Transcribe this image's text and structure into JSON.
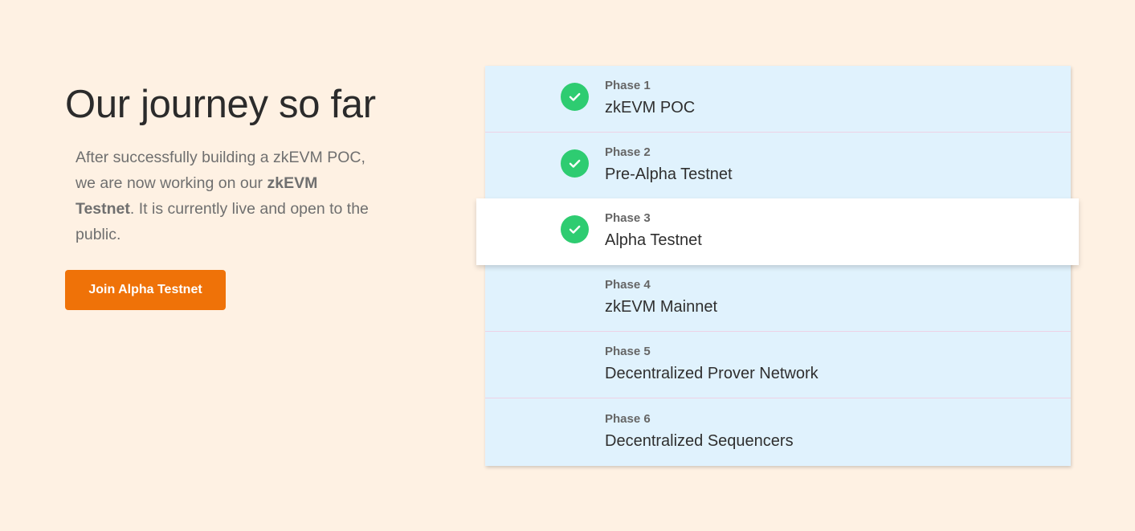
{
  "hero": {
    "title": "Our journey so far",
    "description_part1": "After successfully building a zkEVM POC, we are now working on our ",
    "description_bold": "zkEVM Testnet",
    "description_part2": ". It is currently live and open to the public.",
    "cta_label": "Join Alpha Testnet"
  },
  "phases": [
    {
      "label": "Phase 1",
      "name": "zkEVM POC",
      "completed": true,
      "active": false,
      "icon": "check-circle-icon"
    },
    {
      "label": "Phase 2",
      "name": "Pre-Alpha Testnet",
      "completed": true,
      "active": false,
      "icon": "check-circle-icon"
    },
    {
      "label": "Phase 3",
      "name": "Alpha Testnet",
      "completed": true,
      "active": true,
      "icon": "check-circle-icon"
    },
    {
      "label": "Phase 4",
      "name": "zkEVM Mainnet",
      "completed": false,
      "active": false
    },
    {
      "label": "Phase 5",
      "name": "Decentralized Prover Network",
      "completed": false,
      "active": false
    },
    {
      "label": "Phase 6",
      "name": "Decentralized Sequencers",
      "completed": false,
      "active": false
    }
  ],
  "colors": {
    "page_background": "#fef1e3",
    "timeline_background": "#e0f2fd",
    "accent": "#ef7208",
    "check": "#2ecc71",
    "divider": "#edd2e6"
  }
}
